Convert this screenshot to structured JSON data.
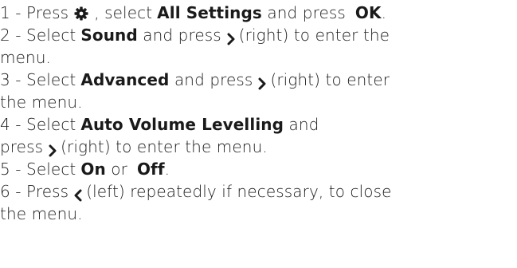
{
  "steps": [
    {
      "prefix": "1 -  Press",
      "icon": "gear-icon",
      "mid1": ", select",
      "bold1": "All Settings",
      "mid2": "and press",
      "bold2": "OK",
      "end": "."
    },
    {
      "prefix": "2 -  Select",
      "bold1": "Sound",
      "mid1": "and press",
      "icon": "chevron-right-icon",
      "end_line1": "(right) to enter the",
      "line2": "menu."
    },
    {
      "prefix": "3 -  Select",
      "bold1": "Advanced",
      "mid1": "and press",
      "icon": "chevron-right-icon",
      "end_line1": "(right) to enter",
      "line2": "the menu."
    },
    {
      "prefix": "4 -  Select",
      "bold1": "Auto Volume Levelling",
      "mid1": "and",
      "line2_prefix": "press",
      "icon": "chevron-right-icon",
      "line2_end": "(right) to enter the menu."
    },
    {
      "prefix": "5 -  Select",
      "bold1": "On",
      "mid1": "or",
      "bold2": "Off",
      "end": "."
    },
    {
      "prefix": "6 -  Press",
      "icon": "chevron-left-icon",
      "end_line1": "(left) repeatedly if necessary, to close",
      "line2": "the menu."
    }
  ]
}
